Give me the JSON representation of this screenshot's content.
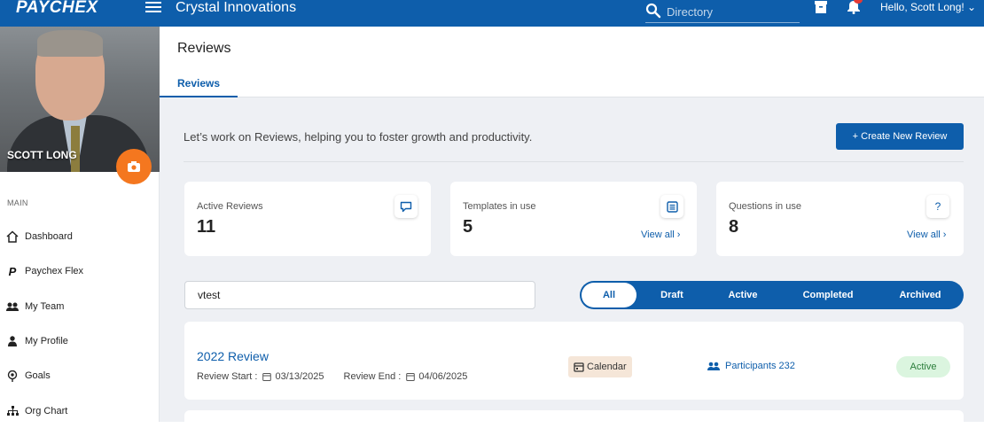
{
  "app": {
    "brand": "PAYCHEX",
    "company": "Crystal Innovations",
    "search_placeholder": "Directory",
    "greeting": "Hello, Scott Long! ⌄",
    "notification_icon": "bell-icon",
    "archive_icon": "archive-icon"
  },
  "sidebar": {
    "user_name": "SCOTT LONG",
    "section_label": "MAIN",
    "items": [
      {
        "label": "Dashboard",
        "icon": "home-icon"
      },
      {
        "label": "Paychex Flex",
        "icon": "paychex-icon"
      },
      {
        "label": "My Team",
        "icon": "team-icon"
      },
      {
        "label": "My Profile",
        "icon": "user-icon"
      },
      {
        "label": "Goals",
        "icon": "goals-icon"
      },
      {
        "label": "Org Chart",
        "icon": "org-chart-icon"
      }
    ]
  },
  "page": {
    "title": "Reviews",
    "tab": "Reviews",
    "intro": "Let’s work on Reviews, helping you to foster growth and productivity.",
    "create_button": "+ Create New Review"
  },
  "stats": [
    {
      "label": "Active Reviews",
      "value": "11",
      "icon": "chat-icon",
      "link": ""
    },
    {
      "label": "Templates in use",
      "value": "5",
      "icon": "list-icon",
      "link": "View all ›"
    },
    {
      "label": "Questions in use",
      "value": "8",
      "icon": "question-icon",
      "link": "View all ›"
    }
  ],
  "filter": {
    "search_value": "vtest",
    "tabs": [
      "All",
      "Draft",
      "Active",
      "Completed",
      "Archived"
    ],
    "active_tab": "All"
  },
  "reviews": [
    {
      "title": "2022 Review",
      "start_label": "Review Start :",
      "start_date": "03/13/2025",
      "end_label": "Review End :",
      "end_date": "04/06/2025",
      "type": "Calendar",
      "participants": "Participants 232",
      "status": "Active"
    }
  ],
  "colors": {
    "brand_blue": "#0e5eab",
    "accent_orange": "#f4771f",
    "status_green_bg": "#dbf5df",
    "calendar_chip_bg": "#f5e6d8"
  }
}
